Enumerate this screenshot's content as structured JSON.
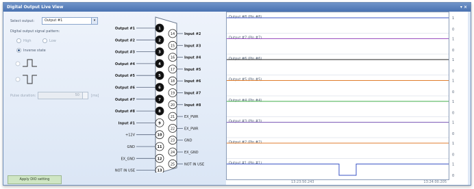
{
  "window": {
    "title": "Digital Output Live View",
    "controls": "▾ ×"
  },
  "left": {
    "select_label": "Select output:",
    "select_value": "Output #1",
    "pattern_label": "Digital output signal pattern:",
    "radio_high": "High",
    "radio_low": "Low",
    "radio_inverse": "Inverse state",
    "pulse_duration_label": "Pulse duration:",
    "pulse_duration_value": "50",
    "pulse_duration_unit": "[ms]",
    "apply_button": "Apply DIO setting"
  },
  "connector": {
    "left_pins": [
      {
        "label": "Output #1",
        "pin": "1"
      },
      {
        "label": "Output #2",
        "pin": "2"
      },
      {
        "label": "Output #3",
        "pin": "3"
      },
      {
        "label": "Output #4",
        "pin": "4"
      },
      {
        "label": "Output #5",
        "pin": "5"
      },
      {
        "label": "Output #6",
        "pin": "6"
      },
      {
        "label": "Output #7",
        "pin": "7"
      },
      {
        "label": "Output #8",
        "pin": "8"
      },
      {
        "label": "Input  #1",
        "pin": "9"
      },
      {
        "label": "+12V",
        "pin": "10"
      },
      {
        "label": "GND",
        "pin": "11"
      },
      {
        "label": "EX_GND",
        "pin": "12"
      },
      {
        "label": "NOT IN USE",
        "pin": "13"
      }
    ],
    "right_pins": [
      {
        "label": "Input  #2",
        "pin": "14"
      },
      {
        "label": "Input  #3",
        "pin": "15"
      },
      {
        "label": "Input  #4",
        "pin": "16"
      },
      {
        "label": "Input  #5",
        "pin": "17"
      },
      {
        "label": "Input  #6",
        "pin": "18"
      },
      {
        "label": "Input  #7",
        "pin": "19"
      },
      {
        "label": "Input  #8",
        "pin": "20"
      },
      {
        "label": "EX_PWR",
        "pin": "21"
      },
      {
        "label": "EX_PWR",
        "pin": "22"
      },
      {
        "label": "GND",
        "pin": "23"
      },
      {
        "label": "EX_GND",
        "pin": "24"
      },
      {
        "label": "NOT IN USE",
        "pin": "25"
      }
    ],
    "active_pin_color": "#111111",
    "inactive_pin_color": "#ffffff"
  },
  "plot": {
    "traces": [
      {
        "label": "Output #8 (Pin #8)",
        "color": "#3a53c4",
        "level": 0
      },
      {
        "label": "Output #7 (Pin #7)",
        "color": "#9a4fc0",
        "level": 0
      },
      {
        "label": "Output #6 (Pin #6)",
        "color": "#222222",
        "level": 0
      },
      {
        "label": "Output #5 (Pin #5)",
        "color": "#e07d2c",
        "level": 0
      },
      {
        "label": "Output #4 (Pin #4)",
        "color": "#3fae4a",
        "level": 0
      },
      {
        "label": "Output #3 (Pin #3)",
        "color": "#7d5bb8",
        "level": 0
      },
      {
        "label": "Output #2 (Pin #2)",
        "color": "#e07d2c",
        "level": 0
      },
      {
        "label": "Output #1 (Pin #1)",
        "color": "#3a53c4",
        "level": 0,
        "pulse": true
      }
    ],
    "scale_top": "1",
    "scale_bottom": "0",
    "time_start": "13:23:50.243",
    "time_end": "13:24:00.205"
  }
}
